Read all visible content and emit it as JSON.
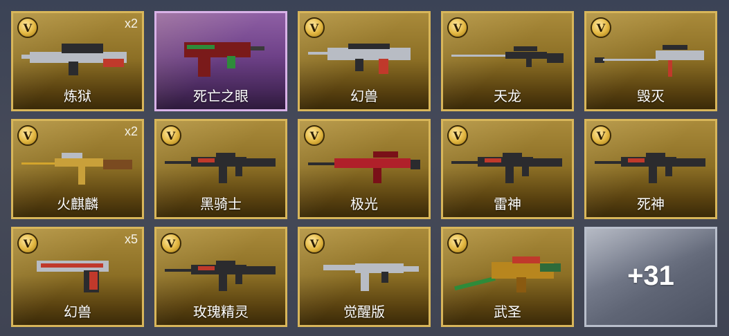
{
  "badge_letter": "V",
  "more_label": "+31",
  "colors": {
    "gold_border": "#d8b65a",
    "purple_border": "#d9b2e8",
    "silver_border": "#b9bfcc"
  },
  "items": [
    {
      "name": "炼狱",
      "count": "x2",
      "tier": "gold",
      "badge": true,
      "icon": "heavy-machine-gun-icon"
    },
    {
      "name": "死亡之眼",
      "count": "",
      "tier": "purple",
      "badge": false,
      "icon": "submachine-gun-icon"
    },
    {
      "name": "幻兽",
      "count": "",
      "tier": "gold",
      "badge": true,
      "icon": "bullpup-rifle-icon"
    },
    {
      "name": "天龙",
      "count": "",
      "tier": "gold",
      "badge": true,
      "icon": "sniper-rifle-icon"
    },
    {
      "name": "毁灭",
      "count": "",
      "tier": "gold",
      "badge": true,
      "icon": "anti-materiel-rifle-icon"
    },
    {
      "name": "火麒麟",
      "count": "x2",
      "tier": "gold",
      "badge": true,
      "icon": "ak-rifle-icon"
    },
    {
      "name": "黑骑士",
      "count": "",
      "tier": "gold",
      "badge": true,
      "icon": "m4-rifle-icon"
    },
    {
      "name": "极光",
      "count": "",
      "tier": "gold",
      "badge": true,
      "icon": "barrett-rifle-icon"
    },
    {
      "name": "雷神",
      "count": "",
      "tier": "gold",
      "badge": true,
      "icon": "m4-rifle-icon"
    },
    {
      "name": "死神",
      "count": "",
      "tier": "gold",
      "badge": true,
      "icon": "m4-rifle-icon"
    },
    {
      "name": "幻兽",
      "count": "x5",
      "tier": "gold",
      "badge": true,
      "icon": "pistol-icon"
    },
    {
      "name": "玫瑰精灵",
      "count": "",
      "tier": "gold",
      "badge": true,
      "icon": "m4-rifle-icon"
    },
    {
      "name": "觉醒版",
      "count": "",
      "tier": "gold",
      "badge": true,
      "icon": "smg-rifle-icon"
    },
    {
      "name": "武圣",
      "count": "",
      "tier": "gold",
      "badge": true,
      "icon": "dragon-rifle-icon"
    }
  ]
}
